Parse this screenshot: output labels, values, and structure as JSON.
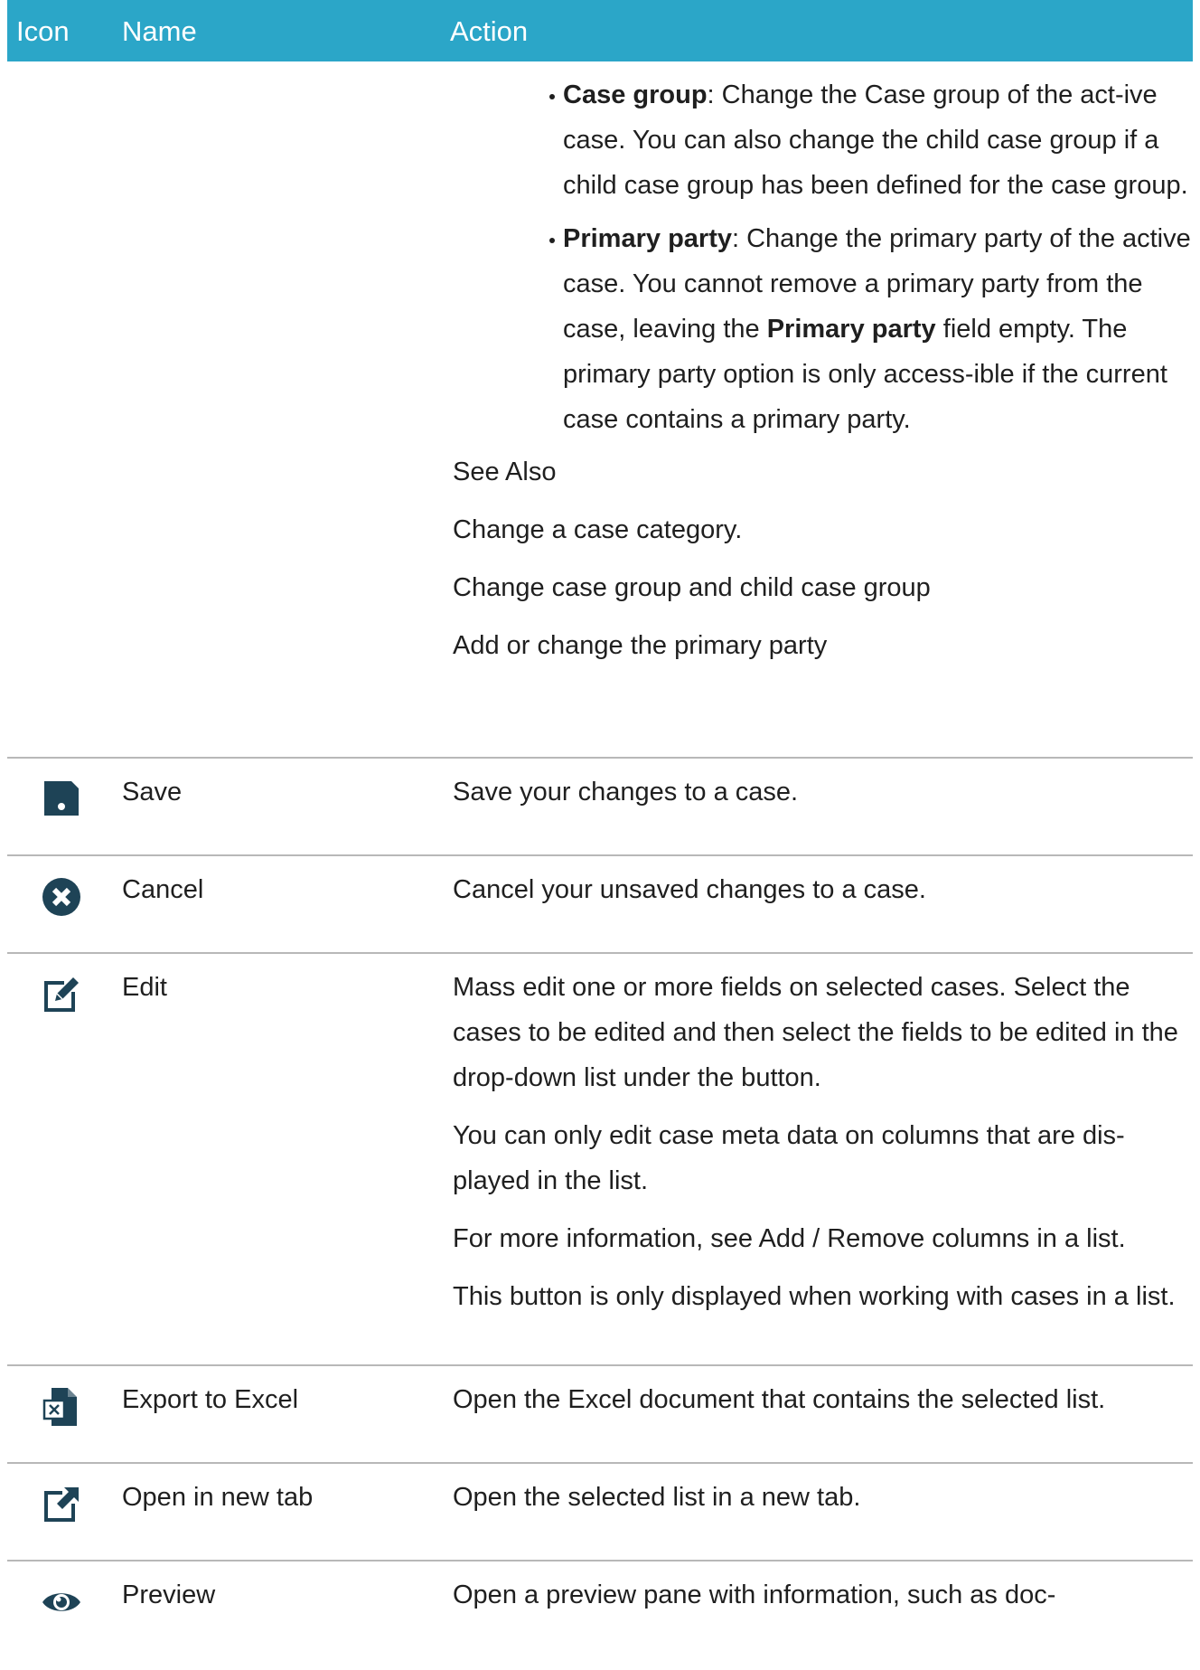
{
  "header": {
    "icon": "Icon",
    "name": "Name",
    "action": "Action"
  },
  "continuation": {
    "bullets": [
      {
        "term": "Case group",
        "text": ": Change the Case group of the act-ive case. You can also change the child case group if a child case group has been defined for the case group."
      },
      {
        "term": "Primary party",
        "text_before": ": Change the primary party of the active case. You cannot remove a primary party from the case, leaving the ",
        "term_inline": "Primary party",
        "text_after": " field empty. The primary party option is only access-ible if the current case contains a primary party."
      }
    ],
    "see_also_title": "See Also",
    "see_also_links": [
      "Change a case category.",
      "Change case group and child case group",
      "Add or change the primary party"
    ]
  },
  "rows": [
    {
      "icon": "save-icon",
      "name": "Save",
      "paragraphs": [
        "Save your changes to a case."
      ]
    },
    {
      "icon": "cancel-icon",
      "name": "Cancel",
      "paragraphs": [
        "Cancel your unsaved changes to a case."
      ]
    },
    {
      "icon": "edit-icon",
      "name": "Edit",
      "paragraphs": [
        "Mass edit one or more fields on selected cases. Select the cases to be edited and then select the fields to be edited in the drop-down list under the button.",
        "You can only edit case meta data on columns that are dis-played in the list.",
        "For more information, see Add / Remove columns in a list.",
        "This button is only displayed when working with cases in a list."
      ]
    },
    {
      "icon": "excel-icon",
      "name": "Export to Excel",
      "paragraphs": [
        "Open the Excel document that contains the selected list."
      ]
    },
    {
      "icon": "open-new-tab-icon",
      "name": "Open in new tab",
      "paragraphs": [
        "Open the selected list in a new tab."
      ]
    },
    {
      "icon": "eye-icon",
      "name": "Preview",
      "paragraphs": [
        "Open a preview pane with information, such as doc-"
      ]
    }
  ],
  "colors": {
    "header_bg": "#2ba6c8",
    "icon": "#1e4356"
  }
}
